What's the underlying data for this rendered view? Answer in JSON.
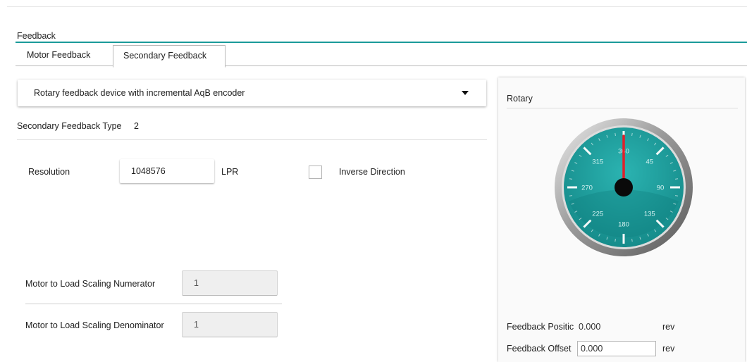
{
  "section": {
    "title": "Feedback"
  },
  "tabs": [
    {
      "label": "Motor Feedback",
      "selected": false
    },
    {
      "label": "Secondary Feedback",
      "selected": true
    }
  ],
  "device_dropdown": {
    "selected": "Rotary feedback device with incremental AqB encoder"
  },
  "secondary_feedback_type": {
    "label": "Secondary Feedback Type",
    "value": "2"
  },
  "resolution": {
    "label": "Resolution",
    "value": "1048576",
    "unit": "LPR"
  },
  "inverse_direction": {
    "label": "Inverse Direction",
    "checked": false
  },
  "scaling": {
    "numerator_label": "Motor to Load Scaling Numerator",
    "numerator_value": "1",
    "denominator_label": "Motor to Load Scaling Denominator",
    "denominator_value": "1"
  },
  "rotary_panel": {
    "title": "Rotary",
    "gauge": {
      "labels": [
        "360",
        "45",
        "90",
        "135",
        "180",
        "225",
        "270",
        "315"
      ],
      "needle_angle_deg": 0,
      "face_color": "#1a9b9a",
      "needle_color": "#e0202a"
    },
    "feedback_position": {
      "label": "Feedback Positic",
      "value": "0.000",
      "unit": "rev"
    },
    "feedback_offset": {
      "label": "Feedback Offset",
      "value": "0.000",
      "unit": "rev"
    }
  }
}
